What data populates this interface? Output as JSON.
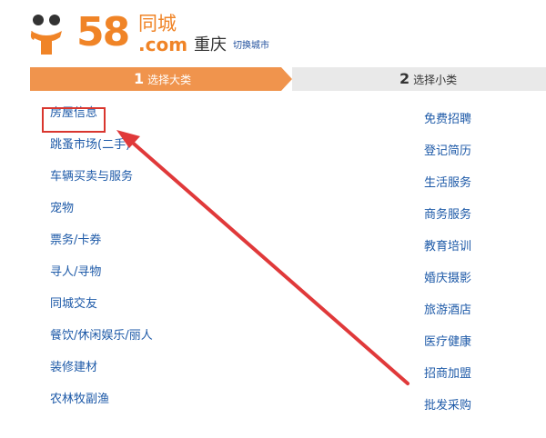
{
  "header": {
    "logo_number": "58",
    "logo_cn": "同城",
    "logo_com": ".com",
    "city": "重庆",
    "switch_city": "切换城市"
  },
  "steps": [
    {
      "num": "1",
      "label": "选择大类",
      "active": true
    },
    {
      "num": "2",
      "label": "选择小类",
      "active": false
    }
  ],
  "categories_left": [
    "房屋信息",
    "跳蚤市场(二手)",
    "车辆买卖与服务",
    "宠物",
    "票务/卡券",
    "寻人/寻物",
    "同城交友",
    "餐饮/休闲娱乐/丽人",
    "装修建材",
    "农林牧副渔"
  ],
  "categories_right": [
    "免费招聘",
    "登记简历",
    "生活服务",
    "商务服务",
    "教育培训",
    "婚庆摄影",
    "旅游酒店",
    "医疗健康",
    "招商加盟",
    "批发采购"
  ],
  "colors": {
    "brand_orange": "#f08427",
    "step_active": "#f0944d",
    "step_inactive": "#e9e9e9",
    "link_blue": "#1e5aa8",
    "annotation_red": "#d9362e"
  }
}
